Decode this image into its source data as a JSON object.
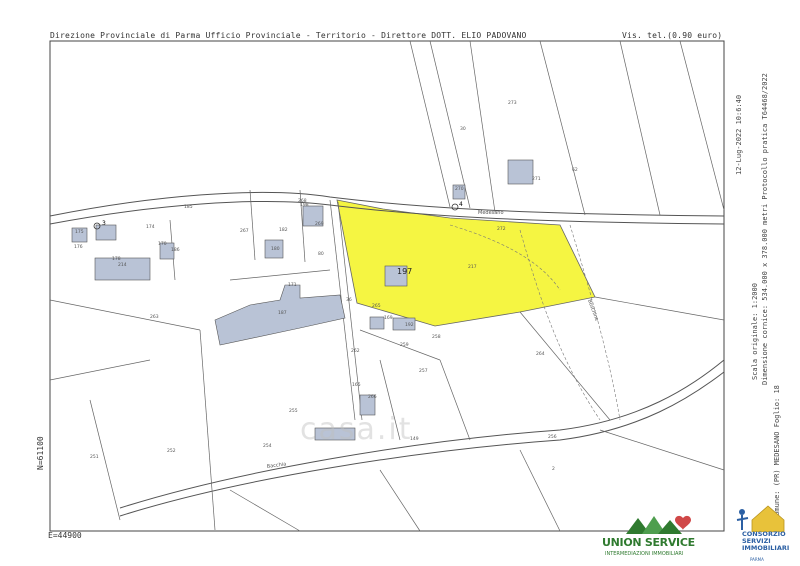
{
  "header": {
    "left": "Direzione Provinciale di Parma  Ufficio Provinciale - Territorio - Direttore DOTT. ELIO PADOVANO",
    "right": "Vis. tel.(0.90 euro)"
  },
  "side_meta": {
    "date": "12-Lug-2022 10:6:40",
    "scale": "Scala originale: 1:2000",
    "frame": "Dimensione cornice: 534.000 x 378.000 metri",
    "protocol": "Protocollo pratica T64468/2022",
    "place": "Comune: (PR) MEDESANO",
    "sheet": "Foglio: 18"
  },
  "coordinates": {
    "north": "N=61100",
    "east": "E=44900"
  },
  "map": {
    "highlight_color": "#f5f542",
    "line_color": "#555555",
    "building_color": "#b9c3d6",
    "highlighted_parcel_number": "197",
    "roads": [
      "Medesano",
      "Boschine",
      "Bacchia"
    ],
    "parcel_labels": [
      "3",
      "4",
      "170",
      "171",
      "174",
      "175",
      "176",
      "178",
      "180",
      "182",
      "185",
      "186",
      "187",
      "197",
      "198",
      "214",
      "217",
      "251",
      "252",
      "254",
      "255",
      "256",
      "257",
      "258",
      "259",
      "262",
      "263",
      "264",
      "265",
      "266",
      "267",
      "268",
      "269",
      "270",
      "271",
      "272",
      "273",
      "30",
      "36",
      "62",
      "149",
      "165",
      "169",
      "192",
      "80",
      "2"
    ]
  },
  "watermark": "casa.it",
  "logos": {
    "union_service": {
      "name": "UNION SERVICE",
      "tagline": "INTERMEDIAZIONI IMMOBILIARI"
    },
    "consorzio": {
      "line1": "CONSORZIO",
      "line2": "SERVIZI",
      "line3": "IMMOBILIARI",
      "city": "PARMA"
    }
  }
}
